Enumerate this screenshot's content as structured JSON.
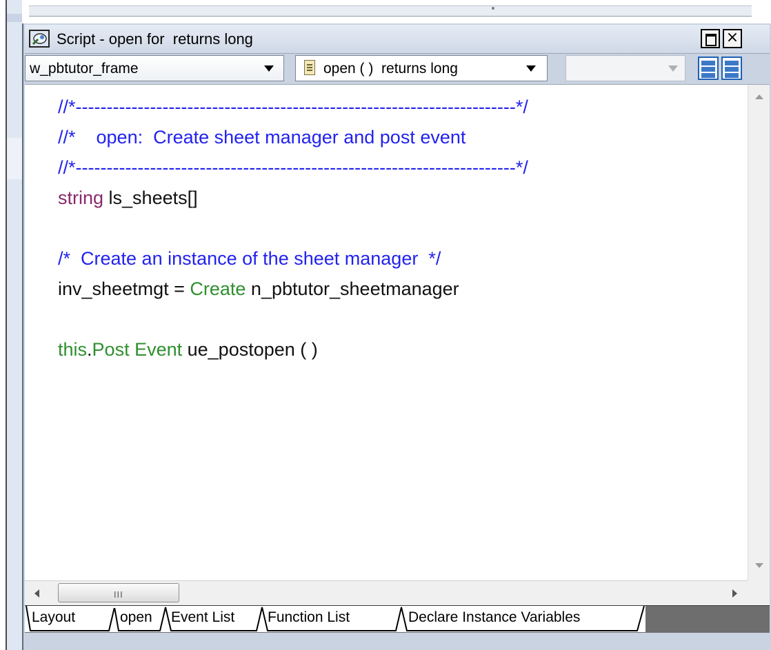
{
  "window": {
    "title": "Script - open for  returns long",
    "close_glyph": "×"
  },
  "toolbar": {
    "object_dropdown": "w_pbtutor_frame",
    "event_dropdown": "open ( )  returns long",
    "extra_dropdown": ""
  },
  "code_lines": [
    [
      {
        "t": "//*-----------------------------------------------------------------------*/",
        "c": "comment"
      }
    ],
    [
      {
        "t": "//*    open:  Create sheet manager and post event",
        "c": "comment"
      }
    ],
    [
      {
        "t": "//*-----------------------------------------------------------------------*/",
        "c": "comment"
      }
    ],
    [
      {
        "t": "string",
        "c": "type"
      },
      {
        "t": " ls_sheets[]",
        "c": "plain"
      }
    ],
    [
      {
        "t": "",
        "c": "plain"
      }
    ],
    [
      {
        "t": "/*  Create an instance of the sheet manager  */",
        "c": "comment"
      }
    ],
    [
      {
        "t": "inv_sheetmgt = ",
        "c": "plain"
      },
      {
        "t": "Create",
        "c": "kw"
      },
      {
        "t": " n_pbtutor_sheetmanager",
        "c": "plain"
      }
    ],
    [
      {
        "t": "",
        "c": "plain"
      }
    ],
    [
      {
        "t": "this",
        "c": "kw"
      },
      {
        "t": ".",
        "c": "plain"
      },
      {
        "t": "Post Event",
        "c": "kw"
      },
      {
        "t": " ue_postopen ( )",
        "c": "plain"
      }
    ]
  ],
  "scrollbar": {
    "grip": "III"
  },
  "tabs": {
    "layout": "Layout",
    "open": "open",
    "event_list": "Event List",
    "function_list": "Function List",
    "declare": "Declare Instance Variables"
  },
  "colors": {
    "comment": "#2222ee",
    "type": "#8a2a6a",
    "keyword": "#2f8f2f",
    "plain": "#111111"
  },
  "icons": {
    "title": "script-window-icon",
    "event": "event-script-icon",
    "layout_a": "split-horizontal-icon",
    "layout_b": "split-vertical-icon"
  }
}
